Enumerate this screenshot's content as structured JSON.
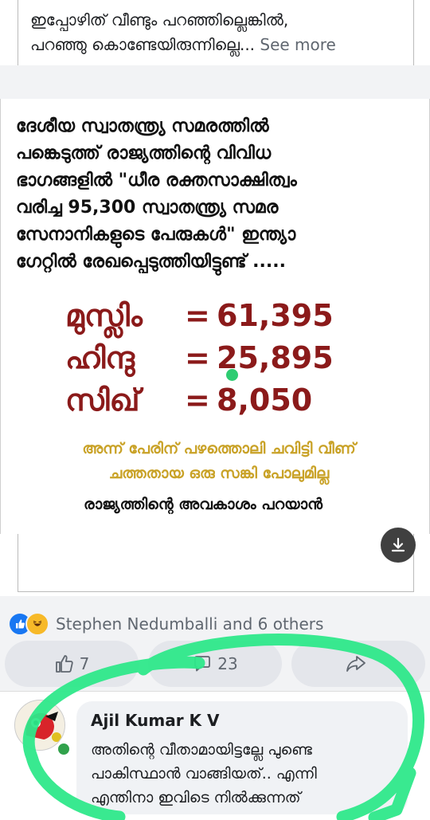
{
  "previous_post": {
    "line1": "ഇപ്പോഴിത് വീണ്ടും പറഞ്ഞില്ലെങ്കിൽ,",
    "line2": "പറഞ്ഞു കൊണ്ടേയിരുന്നില്ലെ...",
    "see_more": "See more"
  },
  "image": {
    "lines": [
      "ദേശീയ സ്വാതന്ത്ര്യ സമരത്തിൽ",
      "പങ്കെടുത്ത് രാജ്യത്തിന്റെ വിവിധ",
      "ഭാഗങ്ങളിൽ \"ധീര രക്തസാക്ഷിത്വം",
      "വരിച്ച 95,300 സ്വാതന്ത്ര്യ സമര",
      "സേനാനികളുടെ പേരുകൾ\" ഇന്ത്യാ",
      "ഗേറ്റിൽ രേഖപ്പെടുത്തിയിട്ടുണ്ട് ....."
    ],
    "stats": [
      {
        "label": "മുസ്ലിം",
        "eq": "=",
        "value": "61,395"
      },
      {
        "label": "ഹിന്ദു",
        "eq": "=",
        "value": "25,895"
      },
      {
        "label": "സിഖ്",
        "eq": "=",
        "value": "8,050"
      }
    ],
    "tagline_1": "അന്ന് പേരിന് പഴത്തൊലി ചവിട്ടി വീണ്",
    "tagline_2": "ചത്തതായ ഒരു സങ്കി പോലുമില്ല",
    "tagline_3": "രാജ്യത്തിന്റെ അവകാശം പറയാൻ"
  },
  "reactions": {
    "icons": [
      "like-icon",
      "haha-icon"
    ],
    "text": "Stephen Nedumballi and 6 others"
  },
  "actions": {
    "like_count": "7",
    "comment_count": "23"
  },
  "comment": {
    "author": "Ajil Kumar K V",
    "line1": "അതിന്റെ വീതാമായിട്ടല്ലേ പുണ്ടെ",
    "line2": "പാകിസ്ഥാൻ വാങ്ങിയത്.. എന്നി",
    "line3": "എന്തിനാ ഇവിടെ നിൽക്കുന്നത്"
  },
  "colors": {
    "stat_red": "#8b1a1a",
    "tagline_gold": "#c9a227",
    "annotation_green": "#2ee88a",
    "facebook_blue": "#1877f2"
  }
}
